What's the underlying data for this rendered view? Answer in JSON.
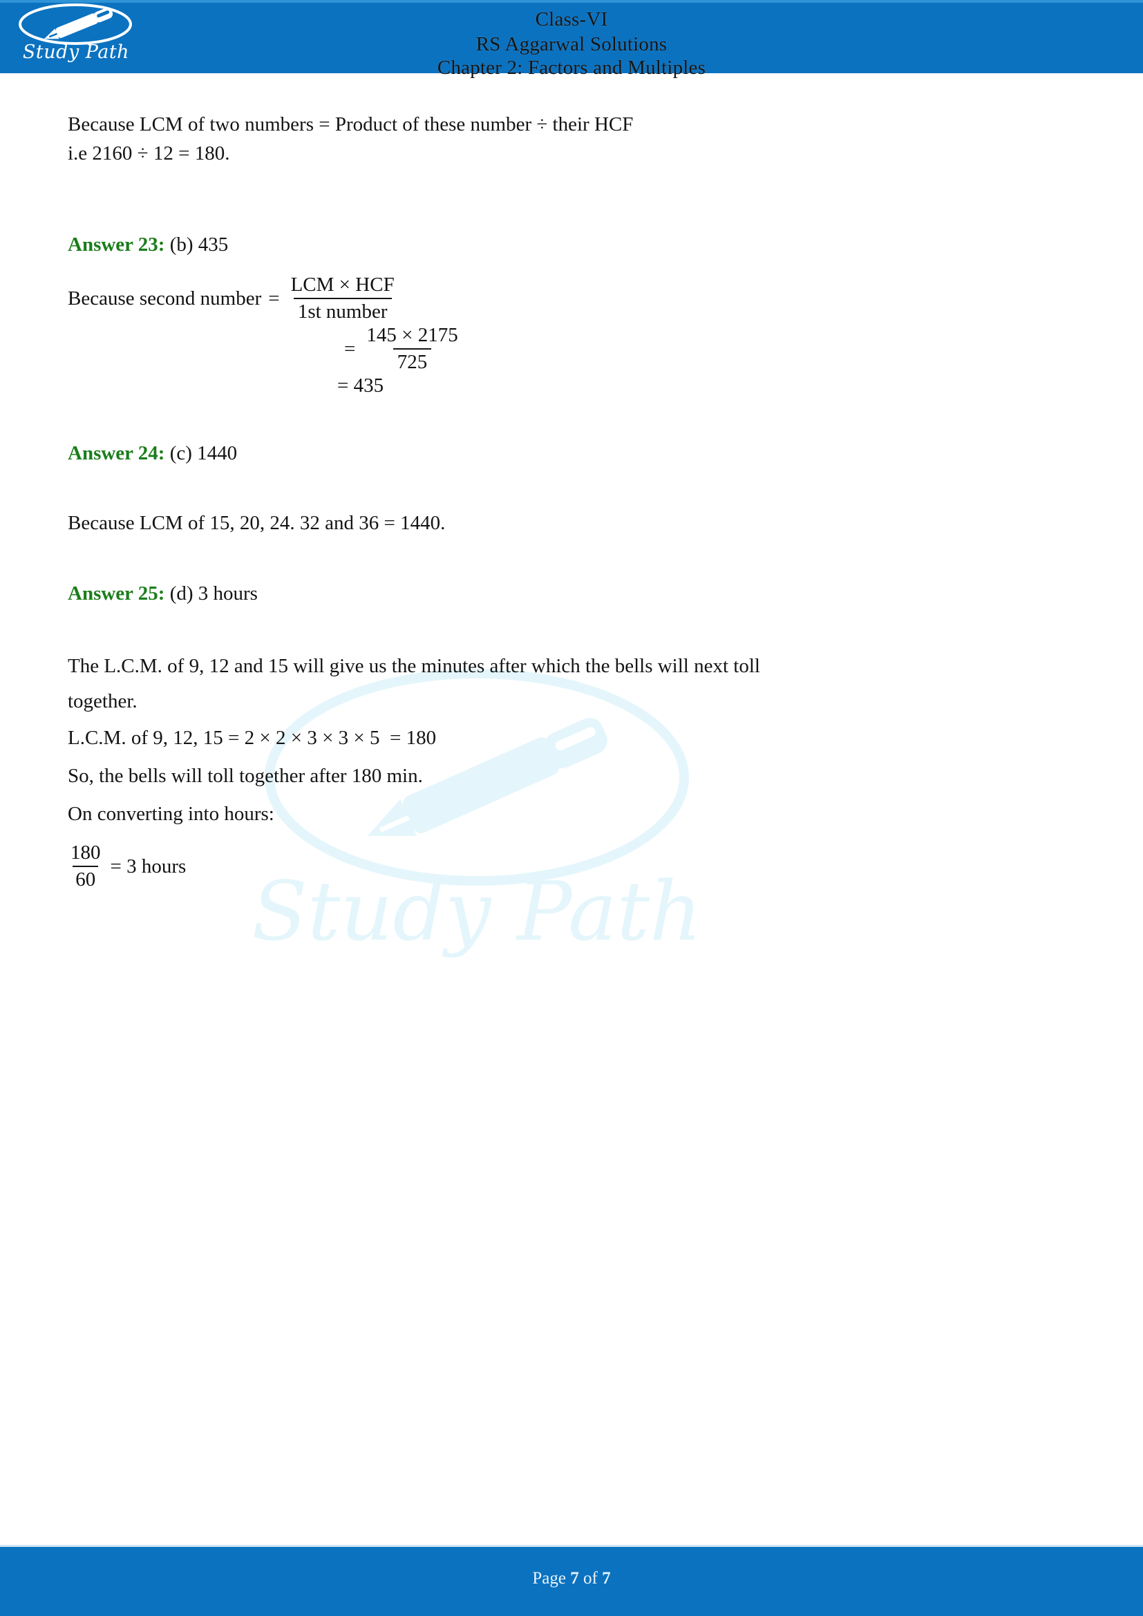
{
  "colors": {
    "header_blue": "#0b72c0",
    "header_top_rule": "#2f93d8",
    "answer_green": "#1b7d1b",
    "body_text": "#141414",
    "watermark_cyan": "#e4f6fb",
    "footer_text": "#eaf4fb"
  },
  "header": {
    "logo_word": "Study Path",
    "logo_icon": "fountain-pen-in-oval",
    "line1": "Class-VI",
    "line2": "RS Aggarwal Solutions",
    "line3": "Chapter 2: Factors and Multiples"
  },
  "watermark": {
    "word": "Study Path",
    "icon": "fountain-pen-in-oval"
  },
  "body": {
    "intro": {
      "line1": "Because LCM of two numbers = Product of these number ÷ their HCF",
      "line2": "i.e 2160 ÷ 12 = 180."
    },
    "answer23": {
      "label": "Answer 23:",
      "value": "(b) 435",
      "eq_lead": "Because second number",
      "eq_equals": "=",
      "frac1_num": "LCM × HCF",
      "frac1_den": "1st number",
      "eq2_equals": "=",
      "frac2_num": "145 × 2175",
      "frac2_den": "725",
      "result": "= 435"
    },
    "answer24": {
      "label": "Answer 24:",
      "value": "(c) 1440",
      "reason": "Because LCM of 15, 20, 24. 32 and 36 = 1440."
    },
    "answer25": {
      "label": "Answer 25:",
      "value": "(d) 3 hours",
      "line1": "The L.C.M. of 9, 12 and 15 will give us the minutes after which the bells will next toll",
      "line2": "together.",
      "line3": "L.C.M. of 9, 12, 15 = 2 × 2 × 3 × 3 × 5  = 180",
      "line4": "So, the bells will toll together after 180 min.",
      "line5": "On converting into hours:",
      "frac_num": "180",
      "frac_den": "60",
      "frac_result": "= 3 hours"
    }
  },
  "footer": {
    "prefix": "Page",
    "current": "7",
    "middle": "of",
    "total": "7"
  }
}
